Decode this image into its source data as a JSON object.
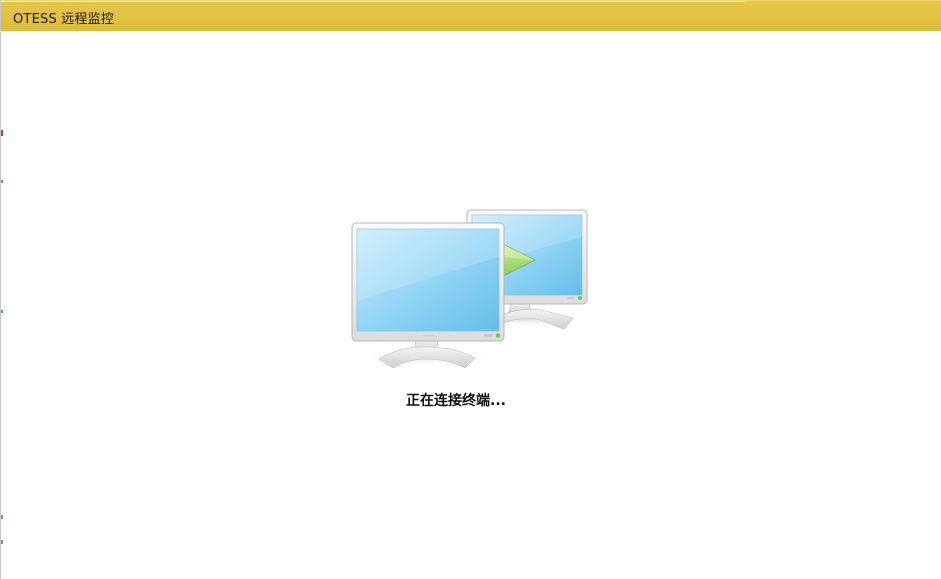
{
  "window": {
    "title": "OTESS  远程监控",
    "accent_color": "#e0c240"
  },
  "main": {
    "status_text": "正在连接终端...",
    "illustration_icon": "two-monitors-connecting-icon",
    "arrow_icon": "green-forward-arrow-icon"
  }
}
